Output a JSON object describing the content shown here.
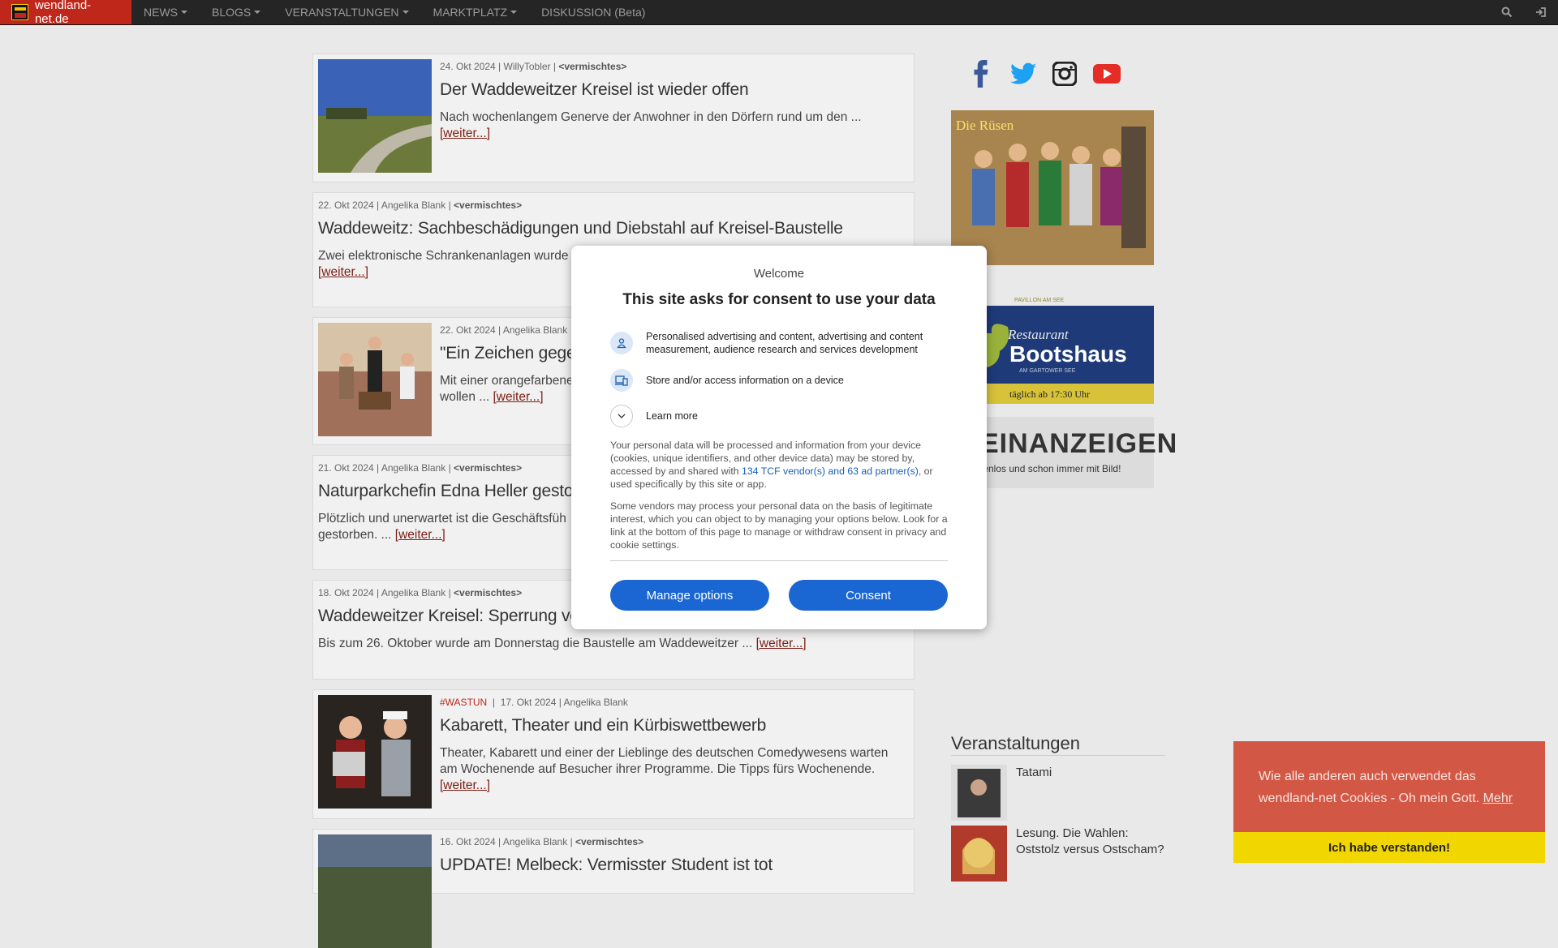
{
  "nav": {
    "brand": "wendland-net.de",
    "items": [
      {
        "label": "NEWS",
        "dropdown": true
      },
      {
        "label": "BLOGS",
        "dropdown": true
      },
      {
        "label": "VERANSTALTUNGEN",
        "dropdown": true
      },
      {
        "label": "MARKTPLATZ",
        "dropdown": true
      },
      {
        "label": "DISKUSSION (Beta)",
        "dropdown": false
      }
    ],
    "right_icons": [
      "search-icon",
      "login-icon"
    ]
  },
  "articles": [
    {
      "date": "24. Okt 2024",
      "author": "WillyTobler",
      "category": "<vermischtes>",
      "title": "Der Waddeweitzer Kreisel ist wieder offen",
      "excerpt": "Nach wochenlangem Generve der Anwohner in den Dörfern rund um den ...",
      "more": "[weiter...]"
    },
    {
      "date": "22. Okt 2024",
      "author": "Angelika Blank",
      "category": "<vermischtes>",
      "title": "Waddeweitz: Sachbeschädigungen und Diebstahl auf Kreisel-Baustelle",
      "excerpt": "Zwei elektronische Schrankenanlagen wurde",
      "more": "[weiter...]"
    },
    {
      "date": "22. Okt 2024",
      "author": "Angelika Blank",
      "category": "",
      "title": "\"Ein Zeichen gegen",
      "excerpt_1": "Mit einer orangefarbene",
      "excerpt_2": "wollen ...",
      "more": "[weiter...]"
    },
    {
      "date": "21. Okt 2024",
      "author": "Angelika Blank",
      "category": "<vermischtes>",
      "title": "Naturparkchefin Edna Heller gestorb",
      "excerpt_1": "Plötzlich und unerwartet ist die Geschäftsfüh",
      "excerpt_2": "gestorben. ...",
      "more": "[weiter...]"
    },
    {
      "date": "18. Okt 2024",
      "author": "Angelika Blank",
      "category": "<vermischtes>",
      "title": "Waddeweitzer Kreisel: Sperrung verl",
      "excerpt": "Bis zum 26. Oktober wurde am Donnerstag die Baustelle am Waddeweitzer ...",
      "more": "[weiter...]"
    },
    {
      "hashtag": "#WASTUN",
      "date": "17. Okt 2024",
      "author": "Angelika Blank",
      "title": "Kabarett, Theater und ein Kürbiswettbewerb",
      "excerpt": "Theater, Kabarett und einer der Lieblinge des deutschen Comedywesens warten am Wochenende auf Besucher ihrer Programme. Die Tipps fürs Wochenende.",
      "more": "[weiter...]"
    },
    {
      "date": "16. Okt 2024",
      "author": "Angelika Blank",
      "category": "<vermischtes>",
      "title": "UPDATE! Melbeck: Vermisster Student ist tot"
    }
  ],
  "sidebar": {
    "social": [
      "facebook-icon",
      "twitter-icon",
      "instagram-icon",
      "youtube-icon"
    ],
    "ad1_caption": "Die Rüsen",
    "ad2": {
      "top": "PAVILLON AM SEE",
      "name1": "Restaurant",
      "name2": "Bootshaus",
      "sub": "AM GARTOWER SEE",
      "hours": "täglich ab 17:30 Uhr"
    },
    "ad3": {
      "big": "EINANZEIGEN",
      "small": "tenlos und schon immer mit Bild!"
    },
    "events_title": "Veranstaltungen",
    "events": [
      {
        "title": "Tatami"
      },
      {
        "title": "Lesung. Die Wahlen: Oststolz versus Ostscham?"
      }
    ]
  },
  "consent": {
    "welcome": "Welcome",
    "heading": "This site asks for consent to use your data",
    "purposes": [
      "Personalised advertising and content, advertising and content measurement, audience research and services development",
      "Store and/or access information on a device"
    ],
    "learn_more": "Learn more",
    "legal1_pre": "Your personal data will be processed and information from your device (cookies, unique identifiers, and other device data) may be stored by, accessed by and shared with ",
    "legal1_link": "134 TCF vendor(s) and 63 ad partner(s)",
    "legal1_post": ", or used specifically by this site or app.",
    "legal2": "Some vendors may process your personal data on the basis of legitimate interest, which you can object to by managing your options below. Look for a link at the bottom of this page to manage or withdraw consent in privacy and cookie settings.",
    "manage": "Manage options",
    "consent": "Consent"
  },
  "cookie_banner": {
    "text": "Wie alle anderen auch verwendet das wendland-net Cookies - Oh mein Gott.",
    "more": "Mehr",
    "accept": "Ich habe verstanden!"
  }
}
